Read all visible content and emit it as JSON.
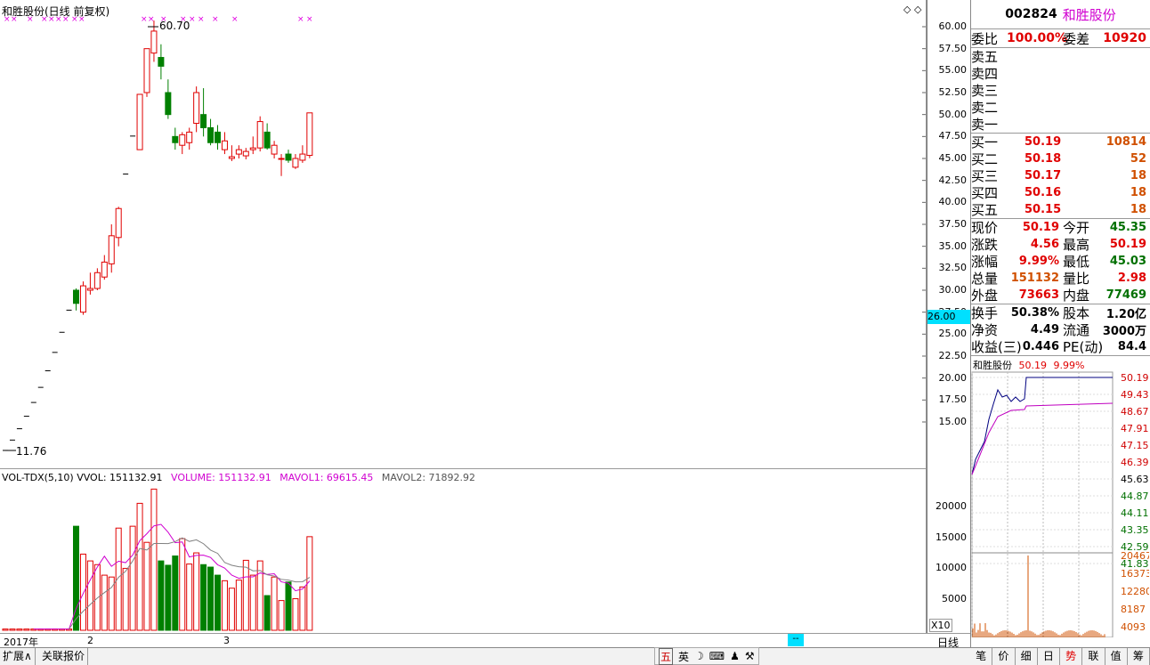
{
  "chart_title": "和胜股份(日线 前复权)",
  "high_marker": "60.70",
  "low_marker": "11.76",
  "vol_indicator": {
    "name": "VOL-TDX(5,10)",
    "vvol": "VVOL: 151132.91",
    "volume": "VOLUME: 151132.91",
    "mavol1": "MAVOL1: 69615.45",
    "mavol2": "MAVOL2: 71892.92"
  },
  "price_axis": [
    "60.00",
    "57.50",
    "55.00",
    "52.50",
    "50.00",
    "47.50",
    "45.00",
    "42.50",
    "40.00",
    "37.50",
    "35.00",
    "32.50",
    "30.00",
    "27.50",
    "25.00",
    "22.50",
    "20.00",
    "17.50",
    "15.00"
  ],
  "price_cursor": "26.00",
  "vol_axis": [
    "20000",
    "15000",
    "10000",
    "5000"
  ],
  "vol_unit": "X10",
  "time_axis": {
    "year": "2017年",
    "m2": "2",
    "m3": "3",
    "cursor": "--"
  },
  "period_label": "日线",
  "bottom_tabs": [
    "扩展∧",
    "关联报价"
  ],
  "ime_items": [
    "五",
    "英",
    "☽",
    "⌨",
    "♟",
    "⚒"
  ],
  "stock": {
    "code": "002824",
    "name": "和胜股份"
  },
  "weibi": {
    "lbl": "委比",
    "val": "100.00%",
    "lbl2": "委差",
    "val2": "10920"
  },
  "sells": [
    {
      "lbl": "卖五"
    },
    {
      "lbl": "卖四"
    },
    {
      "lbl": "卖三"
    },
    {
      "lbl": "卖二"
    },
    {
      "lbl": "卖一"
    }
  ],
  "buys": [
    {
      "lbl": "买一",
      "price": "50.19",
      "vol": "10814"
    },
    {
      "lbl": "买二",
      "price": "50.18",
      "vol": "52"
    },
    {
      "lbl": "买三",
      "price": "50.17",
      "vol": "18"
    },
    {
      "lbl": "买四",
      "price": "50.16",
      "vol": "18"
    },
    {
      "lbl": "买五",
      "price": "50.15",
      "vol": "18"
    }
  ],
  "quote": [
    {
      "l1": "现价",
      "v1": "50.19",
      "l2": "今开",
      "v2": "45.35",
      "c1": "red",
      "c2": "green"
    },
    {
      "l1": "涨跌",
      "v1": "4.56",
      "l2": "最高",
      "v2": "50.19",
      "c1": "red",
      "c2": "red"
    },
    {
      "l1": "涨幅",
      "v1": "9.99%",
      "l2": "最低",
      "v2": "45.03",
      "c1": "red",
      "c2": "green"
    },
    {
      "l1": "总量",
      "v1": "151132",
      "l2": "量比",
      "v2": "2.98",
      "c1": "orange",
      "c2": "red"
    },
    {
      "l1": "外盘",
      "v1": "73663",
      "l2": "内盘",
      "v2": "77469",
      "c1": "red",
      "c2": "green"
    }
  ],
  "fund": [
    {
      "l1": "换手",
      "v1": "50.38%",
      "l2": "股本",
      "v2": "1.20亿"
    },
    {
      "l1": "净资",
      "v1": "4.49",
      "l2": "流通",
      "v2": "3000万"
    },
    {
      "l1": "收益(三)",
      "v1": "0.446",
      "l2": "PE(动)",
      "v2": "84.4"
    }
  ],
  "mini": {
    "title": "和胜股份",
    "price": "50.19",
    "pct": "9.99%",
    "price_ticks": [
      "50.19",
      "49.43",
      "48.67",
      "47.91",
      "47.15",
      "46.39",
      "45.63",
      "44.87",
      "44.11",
      "43.35",
      "42.59",
      "41.83"
    ],
    "vol_ticks": [
      "20467",
      "16373",
      "12280",
      "8187",
      "4093"
    ]
  },
  "right_tabs": [
    "笔",
    "价",
    "细",
    "日",
    "势",
    "联",
    "值",
    "筹"
  ],
  "colors": {
    "up": "#e00000",
    "down": "#008000",
    "ma1": "#d000d0",
    "ma2": "#808080"
  },
  "chart_data": {
    "type": "candlestick",
    "candles": [
      [
        11.76,
        11.76,
        11.76,
        11.76
      ],
      [
        12.94,
        12.94,
        12.94,
        12.94
      ],
      [
        14.23,
        14.23,
        14.23,
        14.23
      ],
      [
        15.65,
        15.65,
        15.65,
        15.65
      ],
      [
        17.22,
        17.22,
        17.22,
        17.22
      ],
      [
        18.94,
        18.94,
        18.94,
        18.94
      ],
      [
        20.83,
        20.83,
        20.83,
        20.83
      ],
      [
        22.92,
        22.92,
        22.92,
        22.92
      ],
      [
        25.21,
        25.21,
        25.21,
        25.21
      ],
      [
        27.73,
        27.73,
        27.73,
        27.73
      ],
      [
        30.0,
        30.2,
        27.7,
        28.5
      ],
      [
        27.5,
        31.0,
        27.2,
        30.5
      ],
      [
        30.0,
        32.0,
        29.5,
        30.2
      ],
      [
        30.2,
        32.5,
        30.0,
        32.0
      ],
      [
        31.5,
        34.0,
        31.2,
        33.2
      ],
      [
        33.0,
        37.5,
        32.0,
        36.2
      ],
      [
        36.0,
        39.5,
        35.0,
        39.3
      ],
      [
        43.23,
        43.23,
        43.23,
        43.23
      ],
      [
        47.55,
        47.55,
        47.55,
        47.55
      ],
      [
        46.0,
        52.3,
        46.0,
        52.3
      ],
      [
        52.5,
        57.5,
        52.0,
        57.5
      ],
      [
        57.0,
        60.7,
        56.0,
        59.5
      ],
      [
        56.5,
        58.0,
        54.0,
        55.5
      ],
      [
        52.5,
        54.0,
        49.5,
        50.0
      ],
      [
        47.5,
        48.5,
        46.0,
        46.8
      ],
      [
        46.5,
        48.0,
        45.5,
        47.7
      ],
      [
        46.8,
        48.5,
        46.0,
        48.0
      ],
      [
        49.0,
        53.2,
        48.0,
        52.5
      ],
      [
        50.0,
        53.0,
        47.5,
        48.5
      ],
      [
        48.5,
        49.5,
        46.5,
        46.8
      ],
      [
        48.0,
        48.8,
        46.0,
        46.8
      ],
      [
        46.0,
        48.0,
        45.5,
        47.0
      ],
      [
        45.0,
        46.5,
        44.7,
        45.2
      ],
      [
        45.5,
        46.5,
        45.0,
        46.0
      ],
      [
        45.3,
        46.2,
        44.9,
        45.8
      ],
      [
        46.0,
        47.5,
        45.5,
        46.2
      ],
      [
        46.2,
        49.8,
        45.8,
        49.2
      ],
      [
        48.0,
        49.0,
        46.0,
        46.2
      ],
      [
        45.5,
        47.0,
        45.0,
        46.5
      ],
      [
        45.0,
        45.5,
        43.0,
        45.0
      ],
      [
        45.5,
        46.0,
        44.5,
        44.8
      ],
      [
        44.0,
        45.5,
        43.8,
        45.0
      ],
      [
        44.8,
        46.5,
        44.5,
        45.5
      ],
      [
        45.35,
        50.19,
        45.03,
        50.19
      ]
    ],
    "volume": [
      200,
      200,
      200,
      200,
      200,
      200,
      200,
      200,
      200,
      200,
      16800,
      12300,
      11200,
      10600,
      8900,
      8600,
      16500,
      10000,
      16800,
      20500,
      14200,
      22800,
      11200,
      10500,
      12000,
      14800,
      10700,
      12500,
      10600,
      10200,
      8900,
      8000,
      6800,
      8100,
      11300,
      8900,
      11200,
      5600,
      8600,
      4800,
      7800,
      5100,
      7000,
      15113
    ],
    "mavol1_label": "MAVOL1",
    "mavol2_label": "MAVOL2"
  }
}
